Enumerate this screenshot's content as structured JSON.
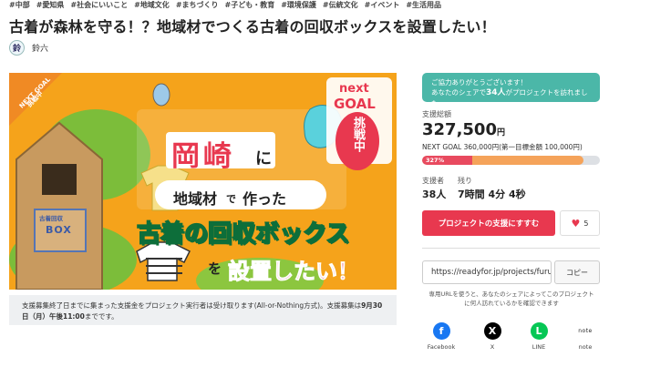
{
  "tags": [
    "#中部",
    "#愛知県",
    "#社会にいいこと",
    "#地域文化",
    "#まちづくり",
    "#子ども・教育",
    "#環境保護",
    "#伝統文化",
    "#イベント",
    "#生活用品"
  ],
  "project_title": "古着が森林を守る！？地域材でつくる古着の回収ボックスを設置したい！",
  "owner": {
    "avatar_text": "鈴",
    "name": "鈴六"
  },
  "hero": {
    "ribbon_line1": "NEXT GOAL",
    "ribbon_line2": "挑戦中",
    "next_goal_line1": "next",
    "next_goal_line2": "GOAL",
    "challenge_text": "挑戦中",
    "city": "岡崎",
    "ni": "に",
    "line2_main": "地域材",
    "line2_de": "で",
    "line2_end": "作った",
    "line3": "古着の回収ボックス",
    "line4_wo": "を",
    "line4": "設置したい！",
    "box_sign_top": "古着回収",
    "box_sign": "BOX"
  },
  "notice": {
    "text_before": "支援募集終了日までに集まった支援金をプロジェクト実行者は受け取ります(All-or-Nothing方式)。支援募集は",
    "deadline": "9月30日（月）午後11:00",
    "text_after": "までです。"
  },
  "thanks": {
    "line1": "ご協力ありがとうございます！",
    "line2_before": "あなたのシェアで",
    "count": "34人",
    "line2_after": "がプロジェクトを訪れました。"
  },
  "funding": {
    "total_label": "支援総額",
    "amount": "327,500",
    "currency": "円",
    "next_goal_text": "NEXT GOAL 360,000円(第一目標金額 100,000円)",
    "progress_label": "327%",
    "progress_fraction": 0.91,
    "first_goal_fraction": 0.28
  },
  "stats": {
    "supporters_label": "支援者",
    "supporters_value": "38人",
    "remaining_label": "残り",
    "remaining_value": "7時間 4分 4秒"
  },
  "actions": {
    "support_label": "プロジェクトの支援にすすむ",
    "like_count": "5"
  },
  "share": {
    "url": "https://readyfor.jp/projects/furugi-okazaki",
    "copy_label": "コピー",
    "note": "専用URLを使うと、あなたのシェアによってこのプロジェクトに何人訪れているかを確認できます",
    "items": [
      {
        "label": "Facebook",
        "glyph": "f",
        "color": "#1877f2"
      },
      {
        "label": "X",
        "glyph": "X",
        "color": "#000000"
      },
      {
        "label": "LINE",
        "glyph": "L",
        "color": "#06c755"
      },
      {
        "label": "note",
        "glyph": "note",
        "color": "#ffffff"
      }
    ]
  }
}
